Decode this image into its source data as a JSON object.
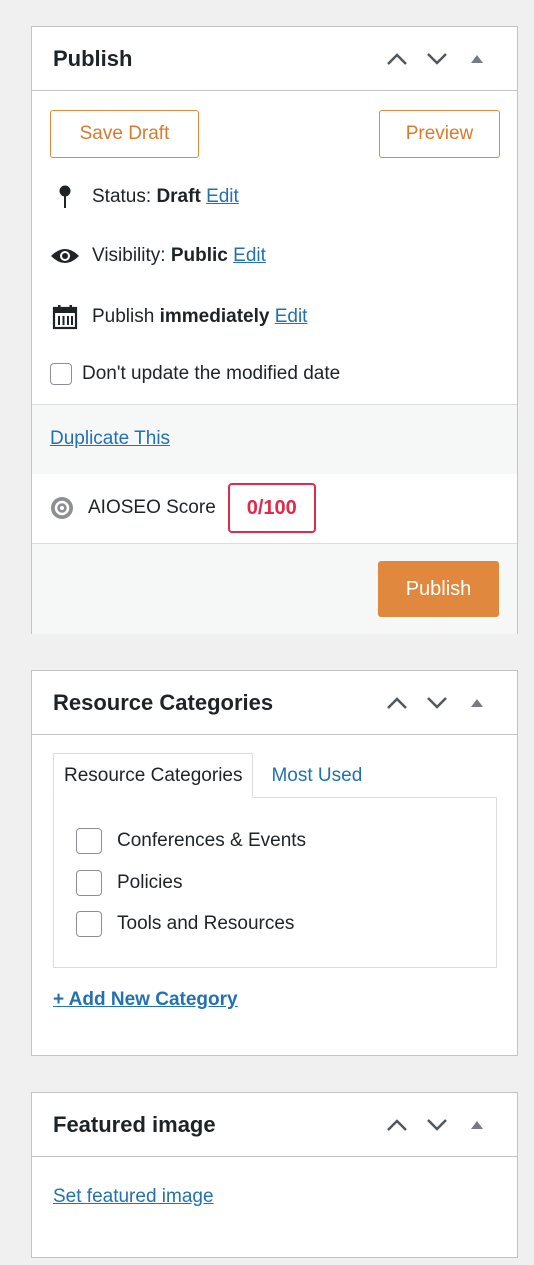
{
  "publish": {
    "title": "Publish",
    "save_draft_label": "Save Draft",
    "preview_label": "Preview",
    "status_label": "Status:",
    "status_value": "Draft",
    "status_edit": "Edit",
    "visibility_label": "Visibility:",
    "visibility_value": "Public",
    "visibility_edit": "Edit",
    "schedule_label": "Publish",
    "schedule_value": "immediately",
    "schedule_edit": "Edit",
    "no_modified_label": "Don't update the modified date",
    "duplicate_label": "Duplicate This",
    "seo_label": "AIOSEO Score",
    "seo_score": "0/100",
    "publish_label": "Publish"
  },
  "categories": {
    "title": "Resource Categories",
    "tab_all": "Resource Categories",
    "tab_popular": "Most Used",
    "items": [
      {
        "label": "Conferences & Events"
      },
      {
        "label": "Policies"
      },
      {
        "label": "Tools and Resources"
      }
    ],
    "add_new": "+ Add New Category"
  },
  "featured": {
    "title": "Featured image",
    "set_link": "Set featured image"
  },
  "icons": {
    "move_up": "chevron-up-icon",
    "move_down": "chevron-down-icon",
    "toggle": "triangle-up-icon",
    "status": "pin-icon",
    "visibility": "eye-icon",
    "schedule": "calendar-icon",
    "seo": "gear-icon"
  },
  "colors": {
    "accent": "#e0883e",
    "link": "#2271b1",
    "seo_bad": "#df2a4a"
  }
}
